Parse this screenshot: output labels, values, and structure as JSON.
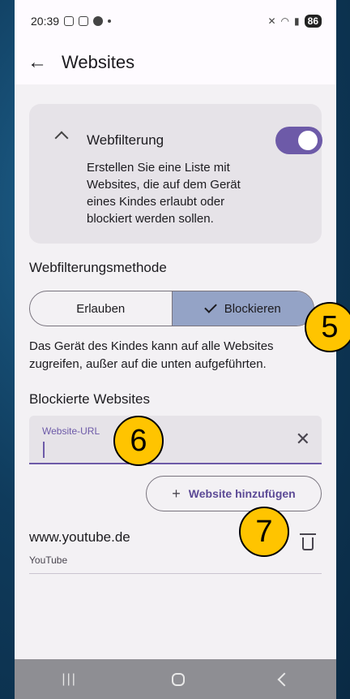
{
  "statusbar": {
    "time": "20:39",
    "battery": "86"
  },
  "appbar": {
    "title": "Websites"
  },
  "webfilter": {
    "title": "Webfilterung",
    "description": "Erstellen Sie eine Liste mit Websites, die auf dem Gerät eines Kindes erlaubt oder blockiert werden sollen.",
    "enabled": true
  },
  "method": {
    "heading": "Webfilterungsmethode",
    "allow_label": "Erlauben",
    "block_label": "Blockieren",
    "selected": "block",
    "helper": "Das Gerät des Kindes kann auf alle Websites zugreifen, außer auf die unten aufgeführten."
  },
  "blocked": {
    "heading": "Blockierte Websites",
    "input_label": "Website-URL",
    "input_value": "",
    "add_label": "Website hinzufügen",
    "items": [
      {
        "url": "www.youtube.de",
        "name": "YouTube"
      }
    ]
  },
  "annotations": {
    "badge_5": "5",
    "badge_6": "6",
    "badge_7": "7"
  },
  "colors": {
    "accent": "#6d5aa8",
    "selected_segment": "#94a3c6",
    "badge": "#ffc400"
  }
}
